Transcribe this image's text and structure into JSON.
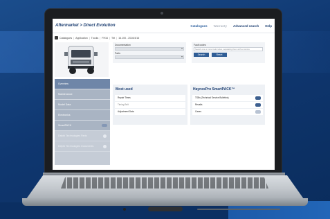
{
  "app": {
    "brand": "Aftermarket > Direct Evolution"
  },
  "topnav": [
    {
      "label": "Catalogues",
      "state": "active"
    },
    {
      "label": "Warranty",
      "state": "muted"
    },
    {
      "label": "Advanced search",
      "state": "normal"
    },
    {
      "label": "Help",
      "state": "normal"
    }
  ],
  "breadcrumb": [
    "Catalogues",
    "Application",
    "Trucks",
    "FH16",
    "Tbt",
    "16.100 - 2016/4/16"
  ],
  "sidebar": {
    "items": [
      {
        "label": "Overview",
        "style": "first"
      },
      {
        "label": "Maintenance",
        "style": "normal"
      },
      {
        "label": "Model Data",
        "style": "normal"
      },
      {
        "label": "Electronics",
        "style": "normal"
      },
      {
        "label": "SmartPACK",
        "style": "normal"
      },
      {
        "label": "Delphi Technologies Parts",
        "style": "faded"
      },
      {
        "label": "Delphi Technologies Documents",
        "style": "faded"
      }
    ]
  },
  "search_left": {
    "documentation_label": "Documentation",
    "parts_label": "Parts"
  },
  "search_right": {
    "fault_codes_label": "Fault codes",
    "fault_codes_placeholder": "Search one or more fault codes, separating them with a comma",
    "search_button": "Search",
    "reset_button": "Reset"
  },
  "most_used": {
    "title": "Most used",
    "rows": [
      {
        "label": "Repair Times",
        "muted": false
      },
      {
        "label": "Timing Belt",
        "muted": true
      },
      {
        "label": "Adjustment Data",
        "muted": false
      }
    ]
  },
  "smartpack": {
    "title": "HaynesPro SmartPACK™",
    "rows": [
      {
        "label": "TSBs (Technical Service Bulletins)",
        "tag": "dark"
      },
      {
        "label": "Recalls",
        "tag": "dark"
      },
      {
        "label": "Cases",
        "tag": "light"
      }
    ]
  }
}
